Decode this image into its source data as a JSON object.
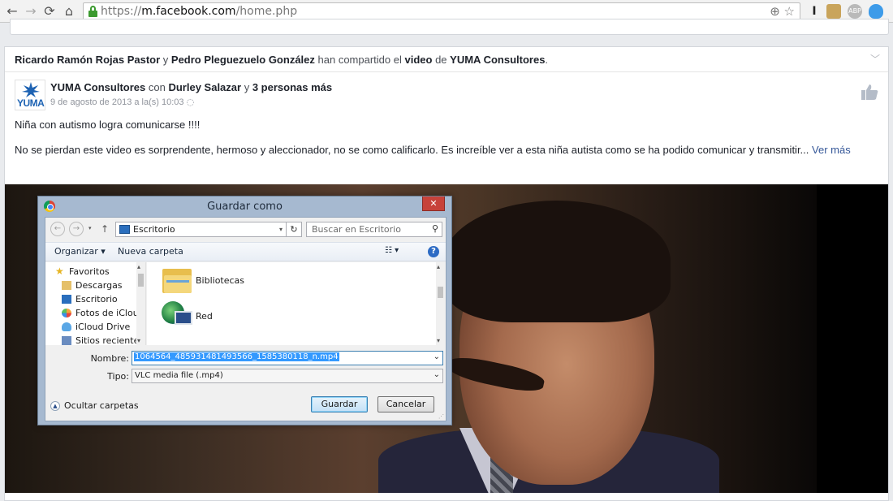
{
  "browser": {
    "url_scheme": "https://",
    "url_host": "m.facebook.com",
    "url_path": "/home.php",
    "back_icon": "arrow-left",
    "forward_icon": "arrow-right",
    "reload_icon": "reload",
    "home_icon": "home",
    "zoom_icon": "magnifier",
    "star_icon": "star",
    "extensions": [
      "cursor-extension",
      "puzzle-extension",
      "abp-extension",
      "cloud-extension"
    ],
    "abp_label": "ABP"
  },
  "post": {
    "shared_by_1": "Ricardo Ramón Rojas Pastor",
    "connector_y": "y",
    "shared_by_2": "Pedro Pleguezuelo González",
    "shared_text": "han compartido el",
    "shared_object": "video",
    "shared_de": "de",
    "shared_page": "YUMA Consultores",
    "shared_end": ".",
    "author": "YUMA Consultores",
    "with_word": "con",
    "tagged": "Durley Salazar",
    "and_word": "y",
    "others": "3 personas más",
    "timestamp": "9 de agosto de 2013 a la(s) 10:03",
    "avatar_text": "YUMA",
    "text_line1": "Niña con autismo logra comunicarse !!!!",
    "text_line2": "No se pierdan este video es sorprendente, hermoso y aleccionador, no se como calificarlo. Es increíble ver a esta niña autista como se ha podido comunicar y transmitir...",
    "see_more": "Ver más"
  },
  "dialog": {
    "title": "Guardar como",
    "close_label": "✕",
    "path_label": "Escritorio",
    "search_placeholder": "Buscar en Escritorio",
    "organize_label": "Organizar ▾",
    "new_folder_label": "Nueva carpeta",
    "nav_items": [
      {
        "label": "Favoritos",
        "icon": "star-icon"
      },
      {
        "label": "Descargas",
        "icon": "downloads-icon"
      },
      {
        "label": "Escritorio",
        "icon": "desktop-icon"
      },
      {
        "label": "Fotos de iCloud",
        "icon": "icloud-photos-icon"
      },
      {
        "label": "iCloud Drive",
        "icon": "icloud-drive-icon"
      },
      {
        "label": "Sitios recientes",
        "icon": "recent-icon"
      }
    ],
    "files": [
      {
        "label": "Bibliotecas",
        "icon": "libraries-icon"
      },
      {
        "label": "Red",
        "icon": "network-icon"
      }
    ],
    "name_label": "Nombre:",
    "name_value": "1064564_485931481493566_1585380118_n.mp4",
    "type_label": "Tipo:",
    "type_value": "VLC media file (.mp4)",
    "hide_folders_label": "Ocultar carpetas",
    "save_label": "Guardar",
    "cancel_label": "Cancelar"
  }
}
